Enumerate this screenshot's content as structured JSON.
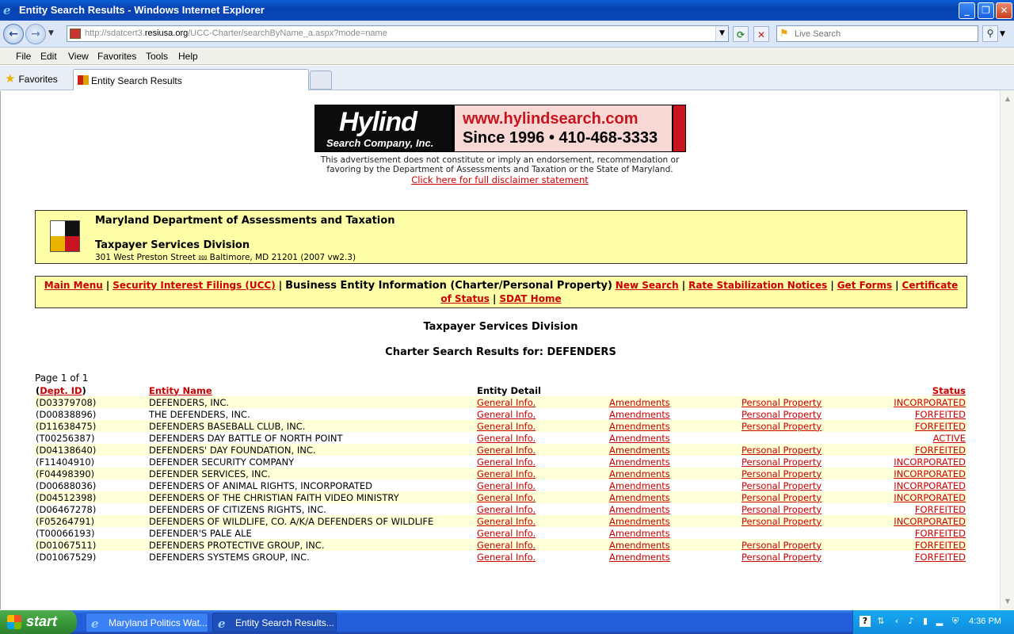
{
  "window": {
    "title": "Entity Search Results - Windows Internet Explorer",
    "minimize": "_",
    "maximize": "❐",
    "close": "✕"
  },
  "address_bar": {
    "url_prefix": "http://sdatcert3.",
    "url_domain": "resiusa.org",
    "url_path": "/UCC-Charter/searchByName_a.aspx?mode=name",
    "search_placeholder": "Live Search"
  },
  "menu": [
    "File",
    "Edit",
    "View",
    "Favorites",
    "Tools",
    "Help"
  ],
  "favorites": {
    "label": "Favorites"
  },
  "tab": {
    "label": "Entity Search Results"
  },
  "ad": {
    "name": "Hylind",
    "company": "Search Company, Inc.",
    "url": "www.hylindsearch.com",
    "since": "Since 1996 • 410-468-3333",
    "disclaimer_line1": "This advertisement does not constitute or imply an endorsement, recommendation or",
    "disclaimer_line2": "favoring by the Department of Assessments and Taxation or the State of Maryland.",
    "disclaimer_link": "Click here for full disclaimer statement"
  },
  "header": {
    "department": "Maryland Department of Assessments and Taxation",
    "division": "Taxpayer Services Division",
    "address": "301 West Preston Street ⅏ Baltimore, MD 21201   (2007 vw2.3)"
  },
  "nav": {
    "main_menu": "Main Menu",
    "ucc": "Security Interest Filings (UCC)",
    "current": "Business Entity Information (Charter/Personal Property)",
    "new_search": "New Search",
    "rate": "Rate Stabilization Notices",
    "forms": "Get Forms",
    "certificate": "Certificate of Status",
    "sdat_home": "SDAT Home"
  },
  "section_title": "Taxpayer Services Division",
  "results_title": "Charter Search Results for: DEFENDERS",
  "page_info": "Page 1 of 1",
  "table": {
    "headers": {
      "dept_id": "Dept. ID",
      "entity_name": "Entity Name",
      "entity_detail": "Entity Detail",
      "status": "Status"
    },
    "rows": [
      {
        "id": "(D03379708)",
        "name": "DEFENDERS, INC.",
        "general": "General Info.",
        "amend": "Amendments",
        "pp": "Personal Property",
        "status": "INCORPORATED"
      },
      {
        "id": "(D00838896)",
        "name": "THE DEFENDERS, INC.",
        "general": "General Info.",
        "amend": "Amendments",
        "pp": "Personal Property",
        "status": "FORFEITED"
      },
      {
        "id": "(D11638475)",
        "name": "DEFENDERS BASEBALL CLUB, INC.",
        "general": "General Info.",
        "amend": "Amendments",
        "pp": "Personal Property",
        "status": "FORFEITED"
      },
      {
        "id": "(T00256387)",
        "name": "DEFENDERS DAY BATTLE OF NORTH POINT",
        "general": "General Info.",
        "amend": "Amendments",
        "pp": "",
        "status": "ACTIVE"
      },
      {
        "id": "(D04138640)",
        "name": "DEFENDERS' DAY FOUNDATION, INC.",
        "general": "General Info.",
        "amend": "Amendments",
        "pp": "Personal Property",
        "status": "FORFEITED"
      },
      {
        "id": "(F11404910)",
        "name": "DEFENDER SECURITY COMPANY",
        "general": "General Info.",
        "amend": "Amendments",
        "pp": "Personal Property",
        "status": "INCORPORATED"
      },
      {
        "id": "(F04498390)",
        "name": "DEFENDER SERVICES, INC.",
        "general": "General Info.",
        "amend": "Amendments",
        "pp": "Personal Property",
        "status": "INCORPORATED"
      },
      {
        "id": "(D00688036)",
        "name": "DEFENDERS OF ANIMAL RIGHTS, INCORPORATED",
        "general": "General Info.",
        "amend": "Amendments",
        "pp": "Personal Property",
        "status": "INCORPORATED"
      },
      {
        "id": "(D04512398)",
        "name": "DEFENDERS OF THE CHRISTIAN FAITH VIDEO MINISTRY",
        "general": "General Info.",
        "amend": "Amendments",
        "pp": "Personal Property",
        "status": "INCORPORATED"
      },
      {
        "id": "(D06467278)",
        "name": "DEFENDERS OF CITIZENS RIGHTS, INC.",
        "general": "General Info.",
        "amend": "Amendments",
        "pp": "Personal Property",
        "status": "FORFEITED"
      },
      {
        "id": "(F05264791)",
        "name": "DEFENDERS OF WILDLIFE, CO. A/K/A DEFENDERS OF WILDLIFE",
        "general": "General Info.",
        "amend": "Amendments",
        "pp": "Personal Property",
        "status": "INCORPORATED"
      },
      {
        "id": "(T00066193)",
        "name": "DEFENDER'S PALE ALE",
        "general": "General Info.",
        "amend": "Amendments",
        "pp": "",
        "status": "FORFEITED"
      },
      {
        "id": "(D01067511)",
        "name": "DEFENDERS PROTECTIVE GROUP, INC.",
        "general": "General Info.",
        "amend": "Amendments",
        "pp": "Personal Property",
        "status": "FORFEITED"
      },
      {
        "id": "(D01067529)",
        "name": "DEFENDERS SYSTEMS GROUP, INC.",
        "general": "General Info.",
        "amend": "Amendments",
        "pp": "Personal Property",
        "status": "FORFEITED"
      }
    ]
  },
  "taskbar": {
    "start": "start",
    "tasks": [
      "Maryland Politics Wat...",
      "Entity Search Results..."
    ],
    "clock": "4:36 PM"
  }
}
